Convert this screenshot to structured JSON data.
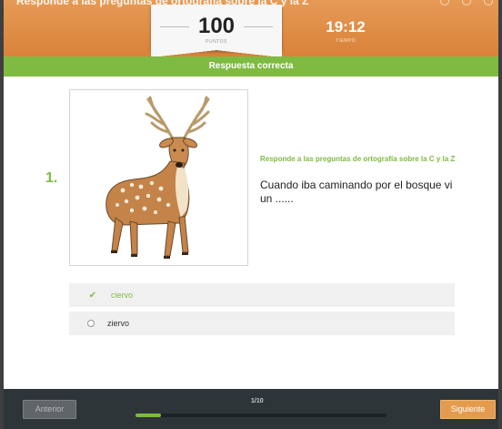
{
  "header": {
    "title": "Responde a las preguntas de ortografía sobre la C y la Z",
    "score": {
      "value": "100",
      "unit": "PUNTOS"
    },
    "timer": {
      "value": "19:12",
      "label": "TIEMPO"
    }
  },
  "result": {
    "text": "Respuesta correcta"
  },
  "question": {
    "number": "1.",
    "image_icon": "deer-illustration",
    "instruction": "Responde a las preguntas de ortografía sobre la C y la Z",
    "text": "Cuando iba caminando por el bosque vi un ......"
  },
  "answers": [
    {
      "label": "ciervo",
      "state": "correct",
      "icon": "check-icon"
    },
    {
      "label": "zierv o",
      "state": "unselected",
      "icon": "radio-icon"
    }
  ],
  "footer": {
    "prev_label": "Anterior",
    "progress_text": "1/10",
    "progress_fraction": 0.1,
    "next_label": "Siguiente"
  },
  "colors": {
    "header": "#d9823a",
    "accent_green": "#7fba42",
    "footer": "#2d3539",
    "next_button": "#e39b4e"
  }
}
